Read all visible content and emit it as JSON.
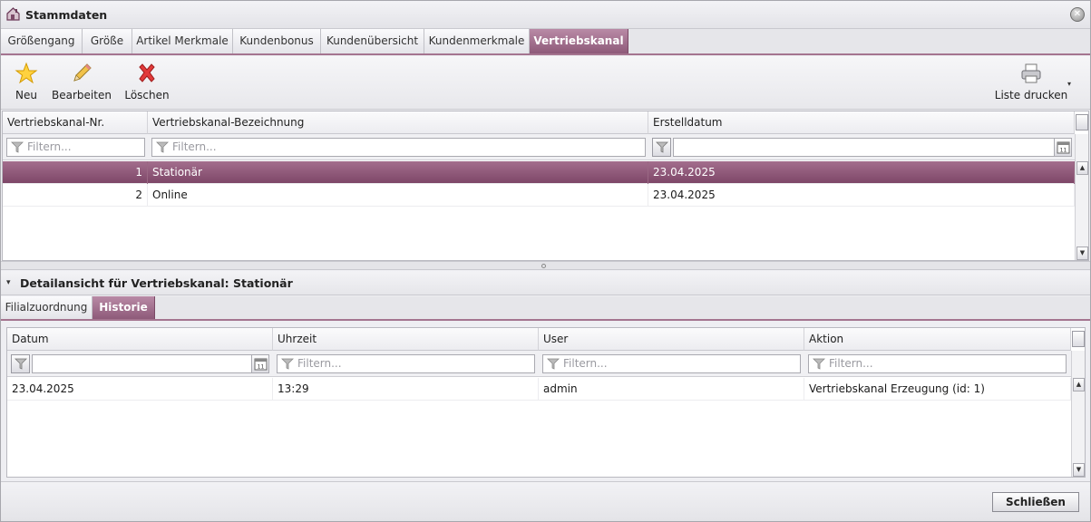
{
  "window": {
    "title": "Stammdaten",
    "close_icon": "close-icon"
  },
  "tabs": [
    {
      "label": "Größengang"
    },
    {
      "label": "Größe"
    },
    {
      "label": "Artikel Merkmale"
    },
    {
      "label": "Kundenbonus"
    },
    {
      "label": "Kundenübersicht"
    },
    {
      "label": "Kundenmerkmale"
    },
    {
      "label": "Vertriebskanal",
      "active": true
    }
  ],
  "toolbar": {
    "new_label": "Neu",
    "edit_label": "Bearbeiten",
    "delete_label": "Löschen",
    "print_label": "Liste drucken",
    "dropdown_caret": "▾"
  },
  "main_grid": {
    "columns": [
      "Vertriebskanal-Nr.",
      "Vertriebskanal-Bezeichnung",
      "Erstelldatum"
    ],
    "filter_placeholder": "Filtern...",
    "rows": [
      {
        "nr": "1",
        "bezeichnung": "Stationär",
        "datum": "23.04.2025",
        "selected": true
      },
      {
        "nr": "2",
        "bezeichnung": "Online",
        "datum": "23.04.2025",
        "selected": false
      }
    ]
  },
  "detail": {
    "title": "Detailansicht für Vertriebskanal: Stationär",
    "collapse_glyph": "▾",
    "tabs": [
      {
        "label": "Filialzuordnung"
      },
      {
        "label": "Historie",
        "active": true
      }
    ]
  },
  "history_grid": {
    "columns": [
      "Datum",
      "Uhrzeit",
      "User",
      "Aktion"
    ],
    "filter_placeholder": "Filtern...",
    "rows": [
      {
        "datum": "23.04.2025",
        "uhrzeit": "13:29",
        "user": "admin",
        "aktion": "Vertriebskanal Erzeugung (id: 1)"
      }
    ]
  },
  "footer": {
    "close_label": "Schließen"
  },
  "colors": {
    "accent": "#8e5a79",
    "selected_row": "#93597b"
  }
}
